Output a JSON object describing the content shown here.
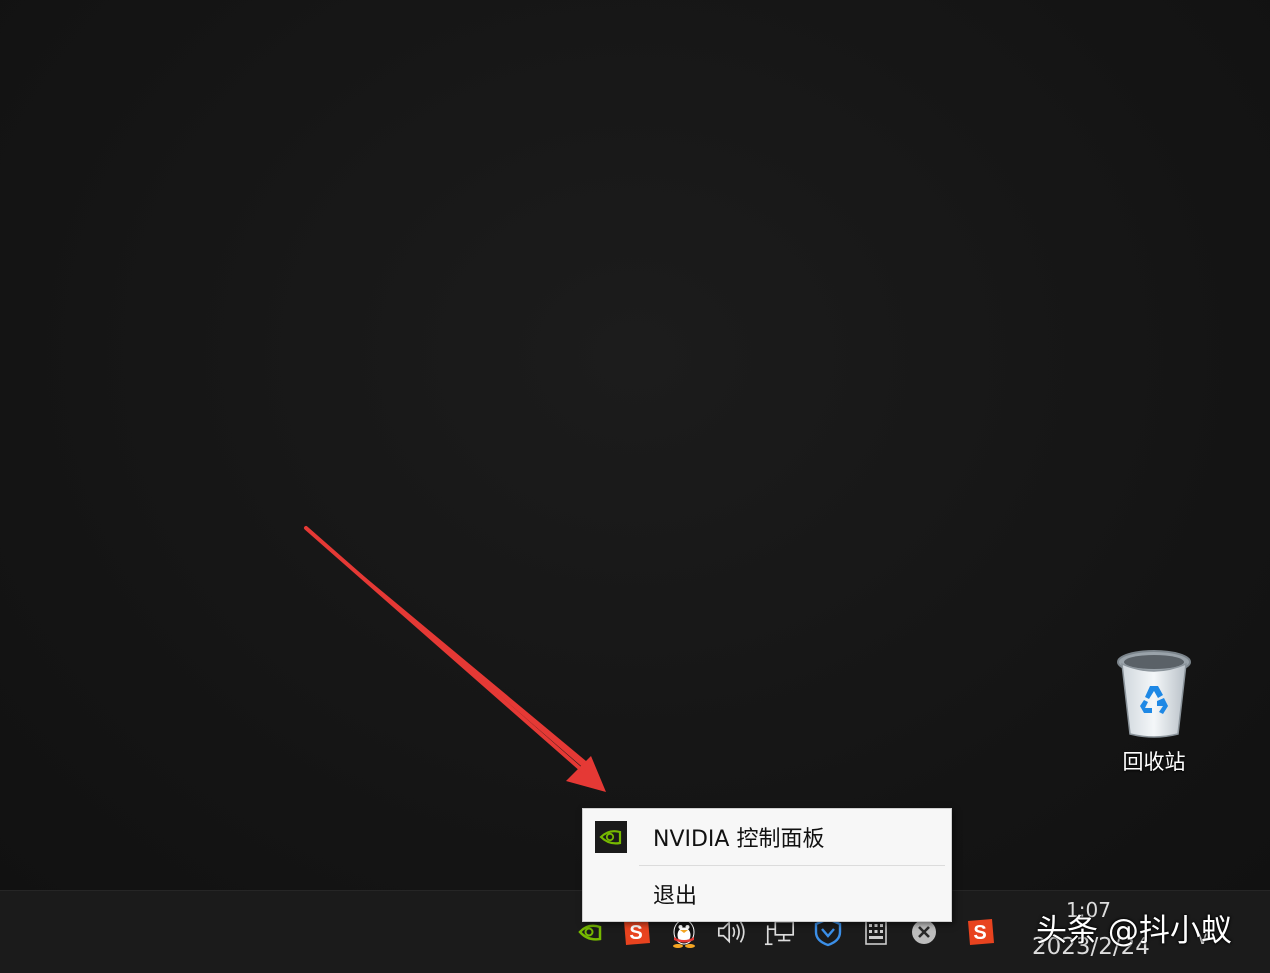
{
  "desktop": {
    "recycle_bin_label": "回收站"
  },
  "context_menu": {
    "items": [
      {
        "label": "NVIDIA 控制面板",
        "icon": "nvidia-icon"
      },
      {
        "label": "退出"
      }
    ]
  },
  "taskbar": {
    "tray_icons": [
      "nvidia-icon",
      "sogou-ime-icon",
      "qq-penguin-icon",
      "volume-icon",
      "network-icon",
      "shield-icon",
      "keyboard-icon",
      "close-circle-icon",
      "sogou-ime-icon",
      "chevron-up-icon"
    ],
    "clock_time": "1:07",
    "clock_date": "2023/2/24"
  },
  "watermark": "头条 @抖小蚁",
  "colors": {
    "arrow": "#e53935",
    "nvidia_green": "#76b900",
    "sogou_red": "#e8431f"
  }
}
